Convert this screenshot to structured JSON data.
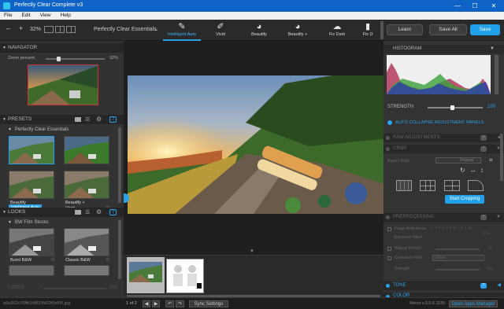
{
  "window": {
    "title": "Perfectly Clear Complete v3",
    "minimize": "—",
    "maximize": "☐",
    "close": "✕"
  },
  "menu": [
    "File",
    "Edit",
    "View",
    "Help"
  ],
  "toolbar": {
    "zoom_out": "–",
    "zoom_in": "+",
    "zoom_level": "32%",
    "preset_group": "Perfectly Clear Essentials",
    "presets": [
      {
        "label": "Intelligent Auto",
        "icon": "hd-brush-icon",
        "active": true
      },
      {
        "label": "Vivid",
        "icon": "brush-icon",
        "active": false
      },
      {
        "label": "Beautify",
        "icon": "face-icon",
        "active": false
      },
      {
        "label": "Beautify +",
        "icon": "face-plus-icon",
        "active": false
      },
      {
        "label": "Fix Dark",
        "icon": "cloud-icon",
        "active": false
      },
      {
        "label": "Fix D",
        "icon": "partial-icon",
        "active": false
      }
    ],
    "learn": "Learn",
    "save_all": "Save All",
    "save": "Save"
  },
  "navigator": {
    "title": "NAVIGATOR",
    "zoom_label": "Zoom percent",
    "zoom_value": "32%",
    "zoom_fraction": 0.32
  },
  "presets": {
    "title": "PRESETS",
    "group": "Perfectly Clear Essentials",
    "items": [
      {
        "label": "Intelligent Auto",
        "selected": true
      },
      {
        "label": "Vivid",
        "selected": false
      },
      {
        "label": "Beautify",
        "selected": false
      },
      {
        "label": "Beautify +",
        "selected": false
      }
    ]
  },
  "looks": {
    "title": "LOOKS",
    "group": "BW Film Stocks",
    "items": [
      {
        "label": "Burnt B&W"
      },
      {
        "label": "Classic B&W"
      }
    ],
    "footer_label": "LOOKS",
    "footer_value": "100"
  },
  "right": {
    "histogram_title": "HISTOGRAM",
    "strength_label": "STRENGTH",
    "strength_value": "100",
    "auto_collapse": "AUTO COLLAPSE ADJUSTMENT PANELS",
    "raw_adjustments": "RAW ADJUSTMENTS",
    "crop": "CROP",
    "aspect_ratio_label": "Aspect Ratio",
    "aspect_ratio_value": "Original",
    "start_cropping": "Start Cropping",
    "preprocessing": "PREPROCESSING",
    "image_ambulance": "Image Ambulance",
    "image_ambulance_scale": "0 .1 .2 .3 .4 .5 .6 .7 .8 .9 .10",
    "image_ambulance_value": "0.00",
    "exposure_value": "Exposure Value",
    "natural_density": "Natural Density",
    "natural_density_value": "70",
    "contrast_filter": "Corrective Filter",
    "contrast_filter_value": "None",
    "strength2": "Strength",
    "strength2_value": "100",
    "tone": "TONE",
    "color": "COLOR"
  },
  "status": {
    "filename": "a9a362c7f9fb1fd815fd29f5ef05.jpg",
    "page": "1 of 2",
    "sync": "Sync Settings",
    "about": "About v.3.5.6.1155",
    "open_apps": "Open Apps Manager"
  },
  "colors": {
    "accent": "#21a0ea",
    "titlebar": "#0f63c6"
  }
}
